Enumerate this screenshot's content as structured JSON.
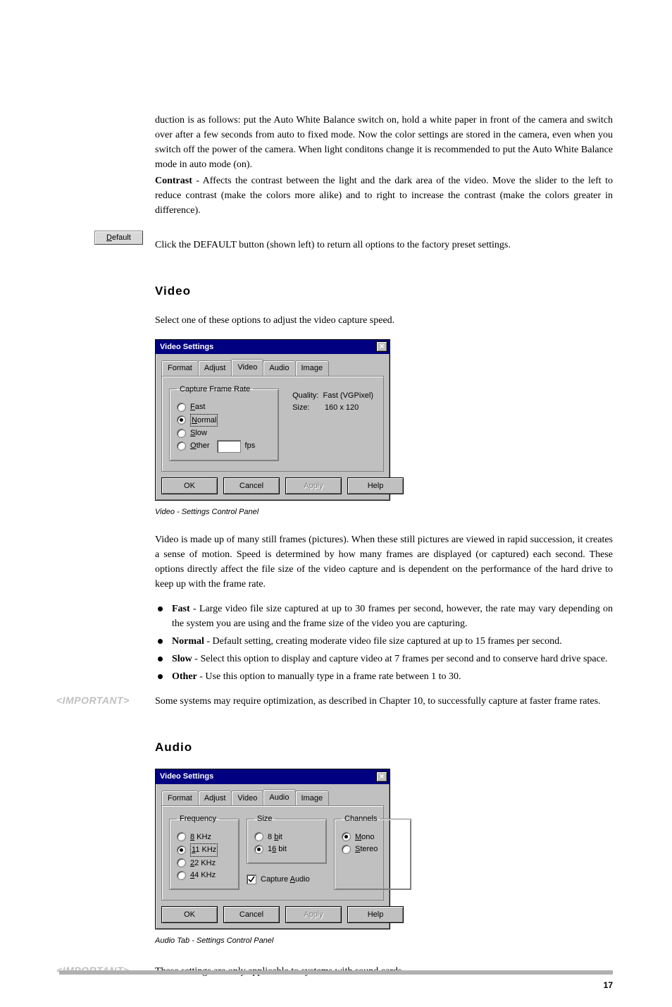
{
  "intro": {
    "para1": "duction is as follows: put the Auto White Balance switch on, hold a white paper in front of the camera and switch over after a few seconds from auto to fixed mode. Now the color settings are stored in the camera, even when you switch off the power of the camera. When light conditons change it is recommended to put the Auto White Balance mode in auto mode (on).",
    "contrast_label": "Contrast",
    "contrast_body": "  -  Affects the contrast between the light and the dark area of the video. Move the slider to the left to reduce contrast (make the colors more alike) and to right to increase the contrast (make the colors greater in difference)."
  },
  "default_btn": {
    "letter": "D",
    "rest": "efault"
  },
  "default_line": "Click the DEFAULT button (shown left) to return all options to the factory preset settings.",
  "video": {
    "heading": "Video",
    "intro": "Select one of these options to adjust the video capture speed.",
    "dialog": {
      "title": "Video Settings",
      "tabs": [
        "Format",
        "Adjust",
        "Video",
        "Audio",
        "Image"
      ],
      "active_tab": 2,
      "group_label": "Capture Frame Rate",
      "options": {
        "fast": {
          "letter": "F",
          "rest": "ast"
        },
        "normal": {
          "letter": "N",
          "rest": "ormal"
        },
        "slow": {
          "letter": "S",
          "rest": "low"
        },
        "other": {
          "letter": "O",
          "rest": "ther"
        }
      },
      "fps_label": "fps",
      "info": {
        "quality_label": "Quality:",
        "quality_value": "Fast (VGPixel)",
        "size_label": "Size:",
        "size_value": "160 x 120"
      },
      "buttons": {
        "ok": "OK",
        "cancel": "Cancel",
        "apply": "Apply",
        "help": "Help"
      }
    },
    "caption": "Video - Settings Control Panel",
    "para": "Video is made up of many still frames (pictures). When these still pictures are viewed in rapid succession, it creates a sense of motion. Speed is determined by how many frames are displayed (or captured) each second. These options directly affect the file size of the video capture and is dependent on the performance of the hard drive to keep up with the frame rate.",
    "bullets": {
      "fast": {
        "label": "Fast",
        "text": " - Large video file size captured at up to 30 frames per second, however, the rate may vary depending on the system you are using and the frame size of the video you are capturing."
      },
      "normal": {
        "label": "Normal",
        "text": " - Default setting, creating moderate video file size captured at up to 15 frames per second."
      },
      "slow": {
        "label": "Slow",
        "text": " - Select this option to display and capture video at 7 frames per second and to conserve hard drive space."
      },
      "other": {
        "label": "Other",
        "text": " - Use this option to manually type in a frame rate between 1 to 30."
      }
    },
    "important_badge": "<IMPORTANT>",
    "important_text": "Some systems may require optimization, as described in Chapter 10, to successfully capture at faster frame rates."
  },
  "audio": {
    "heading": "Audio",
    "dialog": {
      "title": "Video Settings",
      "tabs": [
        "Format",
        "Adjust",
        "Video",
        "Audio",
        "Image"
      ],
      "active_tab": 3,
      "freq": {
        "legend": "Frequency",
        "opts": {
          "k8": {
            "letter": "8",
            "rest": " KHz"
          },
          "k11": {
            "letter": "1",
            "pre": "1",
            "rest": " KHz",
            "display": "11 KHz"
          },
          "k22": {
            "letter": "2",
            "pre": "2",
            "rest": " KHz",
            "display": "22 KHz"
          },
          "k44": {
            "letter": "4",
            "pre": "4",
            "rest": " KHz",
            "display": "44 KHz"
          }
        },
        "labels": {
          "k8": "8 KHz",
          "k11": "11 KHz",
          "k22": "22 KHz",
          "k44": "44 KHz"
        }
      },
      "size": {
        "legend": "Size",
        "opts": {
          "b8": {
            "ul": "b",
            "pre": "8 ",
            "post": "it"
          },
          "b16": {
            "ul": "6",
            "pre": "1",
            "post": " bit"
          }
        },
        "labels": {
          "b8": "8 bit",
          "b16": "16 bit"
        }
      },
      "channels": {
        "legend": "Channels",
        "mono": {
          "ul": "M",
          "rest": "ono"
        },
        "stereo": {
          "ul": "S",
          "rest": "tereo"
        }
      },
      "capture": {
        "label_pre": "Capture ",
        "ul": "A",
        "label_post": "udio"
      },
      "buttons": {
        "ok": "OK",
        "cancel": "Cancel",
        "apply": "Apply",
        "help": "Help"
      }
    },
    "caption": "Audio Tab - Settings Control Panel",
    "important_badge": "<IMPORTANT>",
    "important_text": "These settings are only applicable to systems with sound cards."
  },
  "page_number": "17"
}
